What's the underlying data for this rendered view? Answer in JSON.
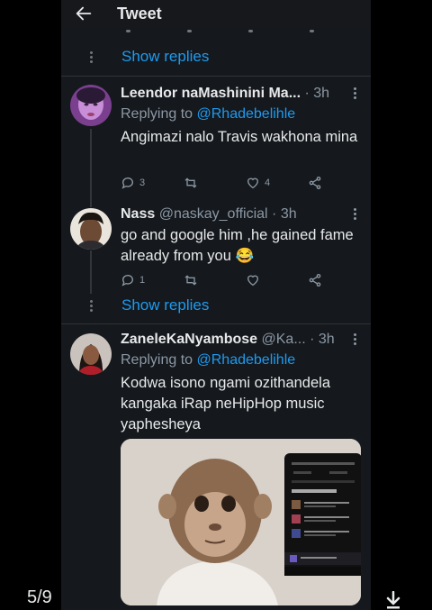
{
  "header": {
    "title": "Tweet"
  },
  "show_replies_1": "Show replies",
  "show_replies_2": "Show replies",
  "tweets": [
    {
      "name": "Leendor naMashinini Ma...",
      "meta": " · 3h",
      "reply_prefix": "Replying to ",
      "reply_to": "@Rhadebelihle",
      "text": "Angimazi nalo Travis wakhona mina",
      "replies": "3",
      "retweets": "",
      "likes": "4"
    },
    {
      "name": "Nass",
      "handle": "@naskay_official",
      "meta": " · 3h",
      "text": "go and google him ,he gained fame already from you 😂",
      "replies": "1",
      "retweets": "",
      "likes": ""
    },
    {
      "name": "ZaneleKaNyambose",
      "handle": "@Ka...",
      "meta": " · 3h",
      "reply_prefix": "Replying to ",
      "reply_to": "@Rhadebelihle",
      "text": "Kodwa isono ngami ozithandela kangaka iRap neHipHop music yaphesheya"
    }
  ],
  "footer": {
    "page_counter": "5/9"
  },
  "colors": {
    "accent": "#1d9bf0",
    "panel": "#15181c",
    "muted": "#8b98a5"
  },
  "icons": [
    "back-arrow-icon",
    "more-icon",
    "reply-icon",
    "retweet-icon",
    "like-icon",
    "share-icon",
    "download-icon"
  ]
}
